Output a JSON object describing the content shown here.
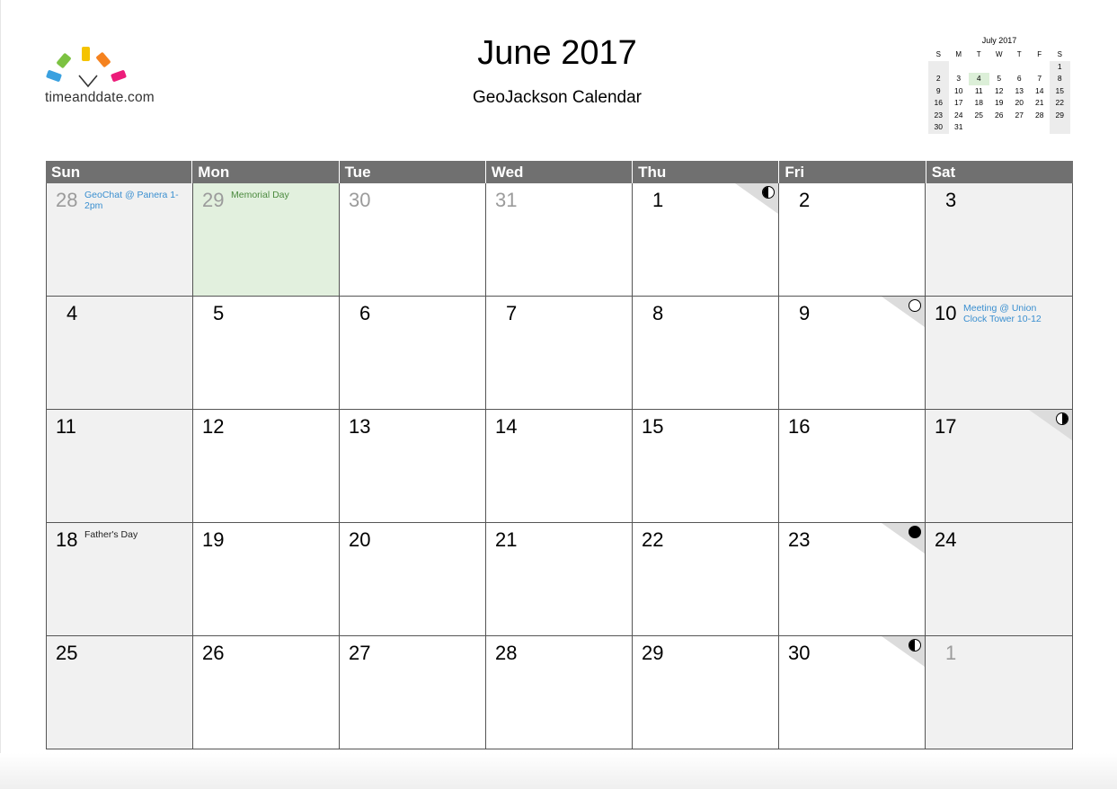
{
  "header": {
    "title": "June 2017",
    "subtitle": "GeoJackson Calendar",
    "logo_text": "timeanddate.com"
  },
  "mini_calendar": {
    "title": "July 2017",
    "weekdays": [
      "S",
      "M",
      "T",
      "W",
      "T",
      "F",
      "S"
    ],
    "weeks": [
      [
        "",
        "",
        "",
        "",
        "",
        "",
        "1"
      ],
      [
        "2",
        "3",
        "4",
        "5",
        "6",
        "7",
        "8"
      ],
      [
        "9",
        "10",
        "11",
        "12",
        "13",
        "14",
        "15"
      ],
      [
        "16",
        "17",
        "18",
        "19",
        "20",
        "21",
        "22"
      ],
      [
        "23",
        "24",
        "25",
        "26",
        "27",
        "28",
        "29"
      ],
      [
        "30",
        "31",
        "",
        "",
        "",
        "",
        ""
      ]
    ],
    "highlight": "4"
  },
  "calendar": {
    "weekdays": [
      "Sun",
      "Mon",
      "Tue",
      "Wed",
      "Thu",
      "Fri",
      "Sat"
    ],
    "weeks": [
      [
        {
          "day": "28",
          "other": true,
          "event": "GeoChat @ Panera 1-2pm",
          "event_color": "blue"
        },
        {
          "day": "29",
          "other": true,
          "holiday": true,
          "event": "Memorial Day",
          "event_color": "green"
        },
        {
          "day": "30",
          "other": true
        },
        {
          "day": "31",
          "other": true
        },
        {
          "day": "1",
          "moon": "first-quarter"
        },
        {
          "day": "2"
        },
        {
          "day": "3"
        }
      ],
      [
        {
          "day": "4"
        },
        {
          "day": "5"
        },
        {
          "day": "6"
        },
        {
          "day": "7"
        },
        {
          "day": "8"
        },
        {
          "day": "9",
          "moon": "full"
        },
        {
          "day": "10",
          "event": "Meeting @ Union Clock Tower 10-12",
          "event_color": "blue"
        }
      ],
      [
        {
          "day": "11"
        },
        {
          "day": "12"
        },
        {
          "day": "13"
        },
        {
          "day": "14"
        },
        {
          "day": "15"
        },
        {
          "day": "16"
        },
        {
          "day": "17",
          "moon": "last-quarter"
        }
      ],
      [
        {
          "day": "18",
          "event": "Father's Day",
          "event_color": "dark"
        },
        {
          "day": "19"
        },
        {
          "day": "20"
        },
        {
          "day": "21"
        },
        {
          "day": "22"
        },
        {
          "day": "23",
          "moon": "new"
        },
        {
          "day": "24"
        }
      ],
      [
        {
          "day": "25"
        },
        {
          "day": "26"
        },
        {
          "day": "27"
        },
        {
          "day": "28"
        },
        {
          "day": "29"
        },
        {
          "day": "30",
          "moon": "first-quarter"
        },
        {
          "day": "1",
          "other": true
        }
      ]
    ]
  },
  "colors": {
    "header_bar": "#707070",
    "weekend_bg": "#f1f1f1",
    "holiday_bg": "#e2f0de",
    "event_blue": "#3a8fd0",
    "event_green": "#4b8a3e",
    "logo": [
      "#3aa1e0",
      "#7cc242",
      "#f5c300",
      "#f5821f",
      "#ec1c7a"
    ]
  }
}
